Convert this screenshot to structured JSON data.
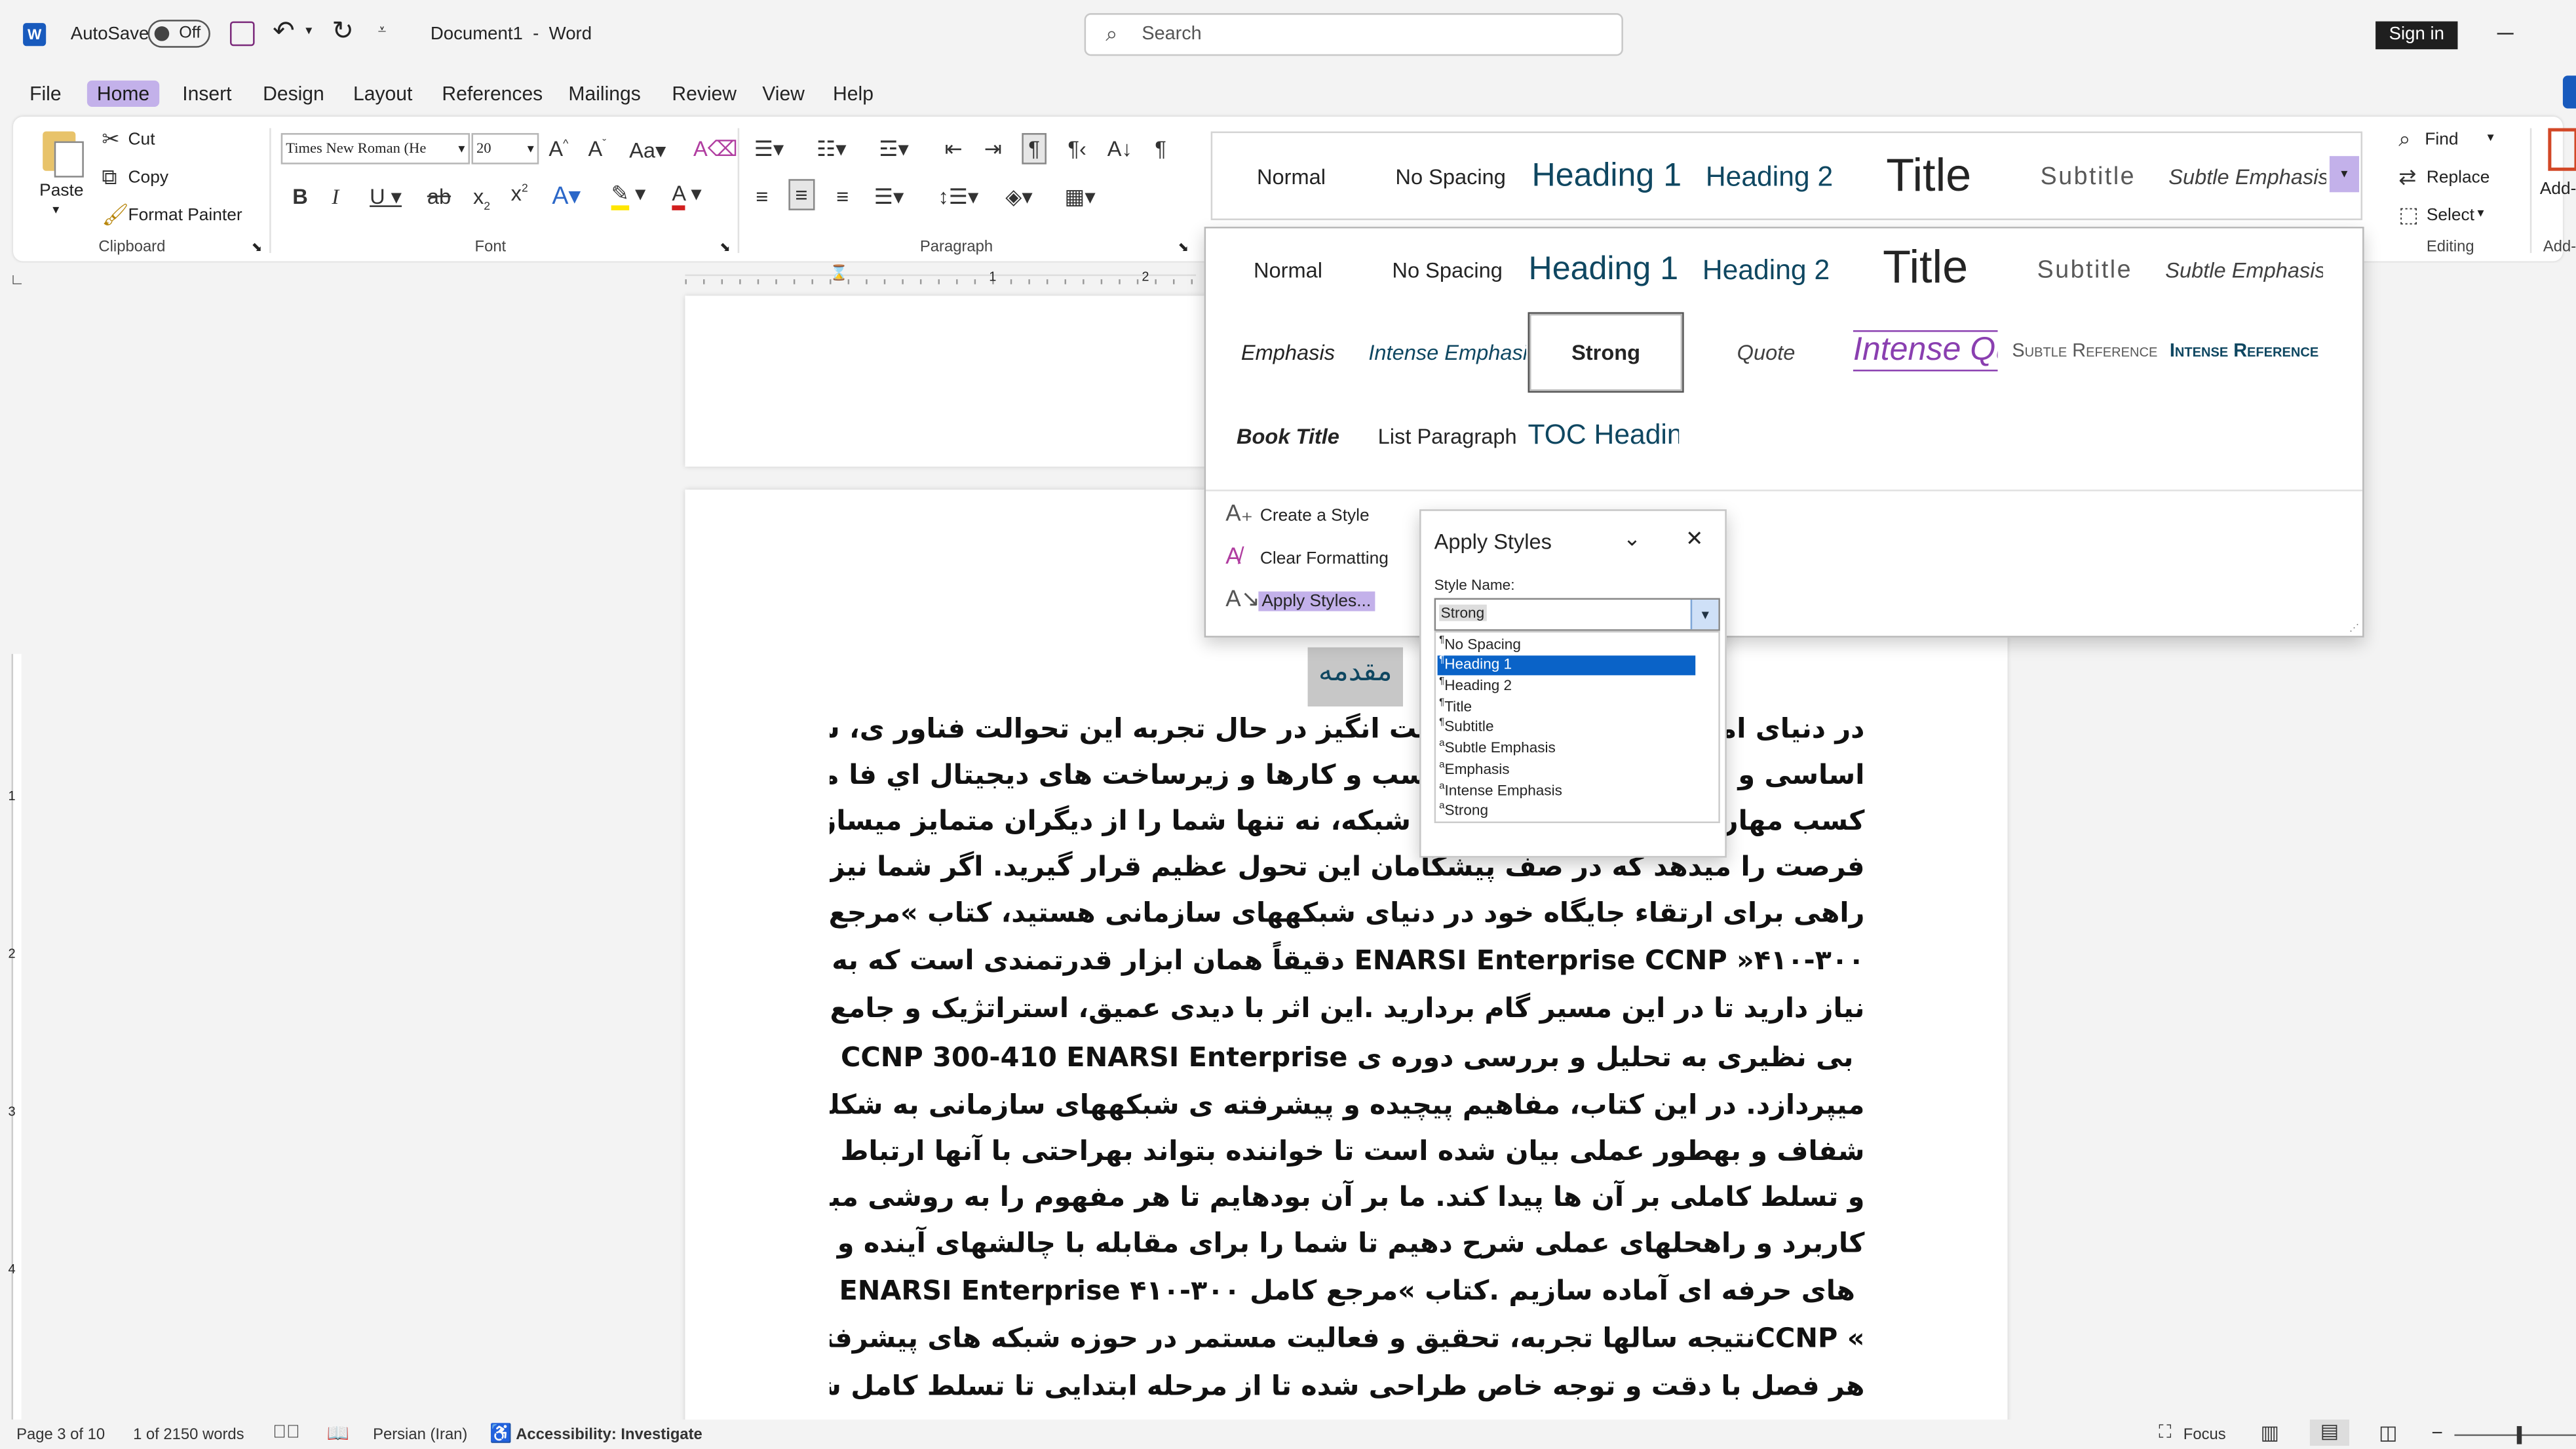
{
  "titlebar": {
    "autosave_label": "AutoSave",
    "autosave_state": "Off",
    "doc_title": "Document1  -  Word",
    "search_placeholder": "Search",
    "signin_label": "Sign in"
  },
  "menu": [
    "File",
    "Home",
    "Insert",
    "Design",
    "Layout",
    "References",
    "Mailings",
    "Review",
    "View",
    "Help"
  ],
  "ribbon": {
    "clipboard": {
      "paste": "Paste",
      "cut": "Cut",
      "copy": "Copy",
      "format_painter": "Format Painter",
      "label": "Clipboard"
    },
    "font": {
      "font_name": "Times New Roman (He",
      "font_size": "20",
      "label": "Font"
    },
    "paragraph": {
      "label": "Paragraph"
    },
    "editing": {
      "find": "Find",
      "replace": "Replace",
      "select": "Select",
      "label": "Editing"
    },
    "addins": {
      "label1": "Add-",
      "label2": "Add-"
    }
  },
  "styles_row": [
    "Normal",
    "No Spacing",
    "Heading 1",
    "Heading 2",
    "Title",
    "Subtitle",
    "Subtle Emphasis"
  ],
  "styles_grid": {
    "row1": [
      "Normal",
      "No Spacing",
      "Heading 1",
      "Heading 2",
      "Title",
      "Subtitle",
      "Subtle Emphasis"
    ],
    "row2": [
      "Emphasis",
      "Intense Emphasis",
      "Strong",
      "Quote",
      "Intense Quote",
      "Subtle Reference",
      "Intense Reference"
    ],
    "row3": [
      "Book Title",
      "List Paragraph",
      "TOC Heading"
    ],
    "actions": [
      "Create a Style",
      "Clear Formatting",
      "Apply Styles..."
    ]
  },
  "apply_styles": {
    "title": "Apply Styles",
    "style_name_label": "Style Name:",
    "value": "Strong",
    "options": [
      "No Spacing",
      "Heading 1",
      "Heading 2",
      "Title",
      "Subtitle",
      "Subtle Emphasis",
      "Emphasis",
      "Intense Emphasis",
      "Strong"
    ],
    "selected": "Heading 1"
  },
  "document": {
    "heading": "مقدمه",
    "lines": [
      "در دنیای امروز که با سرعتی شگفت انگیز در حال تجربه اين تحوالت فناور ی، شبكهاى كامپيوترى نقشى",
      "اساسى و حيات ی را در پيشبرد كسب و كارها و زيرساخت هاى ديجيتال اي فا ميكنند. تسلط بر مفاهيم پيشرفته و",
      "كسب مهارتهای تخصصی در زمینه شبکه، نه تنها شما را از ديگران متمايز ميسازد، بلكه به شما اين",
      "فرصت را ميدهد كه در صف پيشگامان اين تحول عظيم قرار گيريد. اگر شما نيز بهدنبال",
      "راهى براى ارتقاء جايگاه خود در دنياى شبكههاى سازمانى هستيد، كتاب »مرجع كامل",
      "ENARSI Enterprise CCNP »۴۱۰-۳۰۰ دقيقاً همان ابزار قدرتمندى است كه به آن",
      "نياز داريد تا در اين مسير گام برداريد .اين اثر با ديدى عميق، استراتژيک و جامع، بهطور",
      "بى نظيرى به تحليل و بررسى دوره ی CCNP 300-410 ENARSI Enterprise",
      "ميپردازد. در اين كتاب، مفاهيم پيچيده و پيشرفته ی شبكههاى سازمانى به شكلى ساده،",
      "شفاف و بهطور عملى بيان شده است تا خواننده بتواند بهراحتى با آنها ارتباط برقرار كرده",
      "و تسلط كاملى بر آن ها پيدا كند. ما بر آن بودهايم تا هر مفهوم را به روشى مبتنى بر",
      "كاربرد و راهحلهاى عملى شرح دهيم تا شما را براى مقابله با چالشهاى آينده و آزمون",
      "هاى حرفه اى آماده سازيم .كتاب »مرجع كامل ۳۰۰-۴۱۰ ENARSI Enterprise",
      "» CCNPنتيجه سالها تجربه، تحقيق و فعاليت مستمر در حوزه شبكه هاى پيشرفته است.",
      "هر فصل با دقت و توجه خاص طراحى شده تا از مرحله ابتدايى تا تسلط كامل شما را در"
    ]
  },
  "status": {
    "page": "Page 3 of 10",
    "words": "1 of 2150 words",
    "language": "Persian (Iran)",
    "accessibility": "Accessibility: Investigate",
    "focus": "Focus"
  },
  "ruler_numbers": [
    "1",
    "2",
    "1",
    "2",
    "3",
    "4"
  ],
  "colors": {
    "accent": "#c3b1ea",
    "selection": "#0a63c8",
    "heading_blue": "#0f4761",
    "word_blue": "#185abd"
  }
}
